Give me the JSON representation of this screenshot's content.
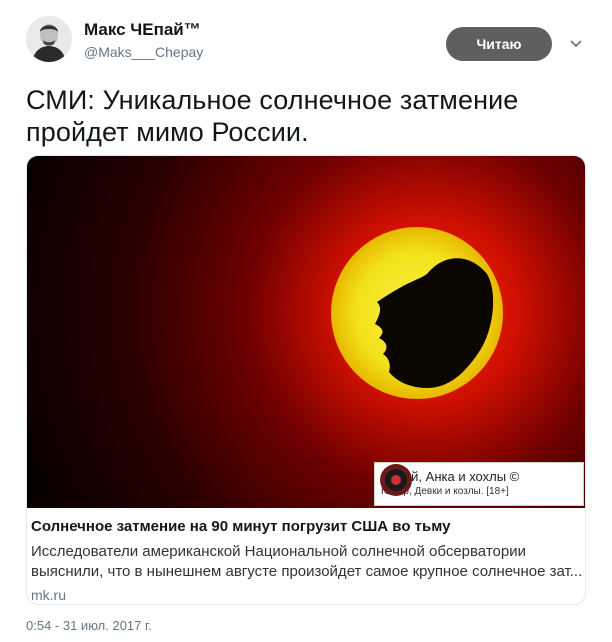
{
  "author": {
    "display_name": "Макс ЧЕпай™",
    "handle": "@Maks___Chepay",
    "avatar_icon": "user-avatar-photo"
  },
  "follow_button": {
    "label": "Читаю"
  },
  "menu_icon": "chevron-down-icon",
  "tweet": {
    "text": "СМИ: Уникальное солнечное затмение пройдет мимо России."
  },
  "card": {
    "image_watermark": {
      "title": "Чапай, Анка и хохлы ©",
      "subtitle": "Юмор, Девки и козлы. [18+]"
    },
    "title": "Солнечное затмение на 90 минут погрузит США во тьму",
    "description_lines": [
      "Исследователи американской Национальной солнечной обсерватории",
      "выяснили, что в нынешнем августе произойдет самое крупное солнечное зат..."
    ],
    "domain": "mk.ru"
  },
  "timestamp": "0:54 - 31 июл. 2017 г.",
  "colors": {
    "button_bg": "#5f5f5f",
    "muted_text": "#657786",
    "card_border": "#e1e8ed"
  }
}
